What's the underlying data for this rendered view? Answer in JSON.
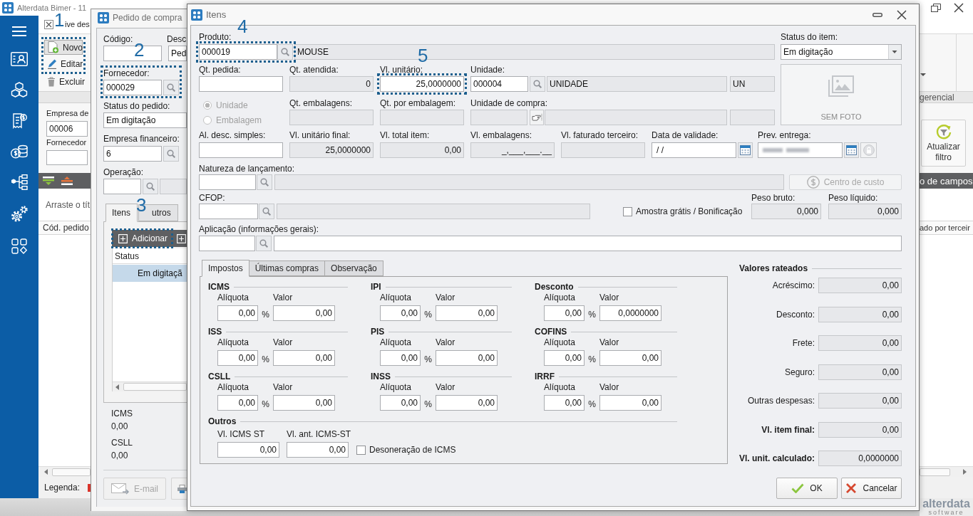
{
  "app": {
    "title": "Alterdata Bimer - 11",
    "ribbon": {
      "tab_fragment": "ive des",
      "groups": [
        {
          "callout": "1",
          "buttons": [
            {
              "label": "Novo",
              "kind": "new",
              "pressed": true
            },
            {
              "label": "Editar",
              "kind": "edit",
              "pressed": false
            }
          ]
        },
        {
          "buttons": [
            {
              "label": "Excluir",
              "kind": "delete",
              "pressed": false
            }
          ]
        }
      ],
      "group_label": "gerencial",
      "refresh_button": "Atualizar filtro"
    },
    "filters": [
      {
        "label": "Empresa de",
        "value": "00006"
      },
      {
        "label": "Fornecedor"
      }
    ],
    "group_hint": "Arraste o tít",
    "fields_bar": "o de campos",
    "grid_columns": [
      "Cód. pedido",
      "ado por terceir"
    ],
    "legend": "Legenda:",
    "logo": {
      "name": "alterdata",
      "tagline": "software"
    }
  },
  "order_window": {
    "title": "Pedido de compra",
    "code": {
      "label": "Código:"
    },
    "description": {
      "label": "Desc",
      "value": "Ped"
    },
    "supplier": {
      "label": "Fornecedor:",
      "value": "000029",
      "callout": "2"
    },
    "status": {
      "label": "Status do pedido:",
      "value": "Em digitação"
    },
    "financial_company": {
      "label": "Empresa financeiro:",
      "value": "6"
    },
    "operation": {
      "label": "Operação:"
    },
    "tabs": [
      {
        "label": "Itens",
        "selected": true
      },
      {
        "label": "utros",
        "selected": false
      }
    ],
    "add_button": {
      "label": "Adicionar",
      "callout": "3"
    },
    "grid": {
      "column": "Status",
      "rows": [
        {
          "status": "Em digitaçã",
          "selected": true
        }
      ]
    },
    "totals": [
      {
        "label": "ICMS",
        "value": "0,00"
      },
      {
        "label": "CSLL",
        "value": "0,00"
      }
    ],
    "email_button": {
      "label": "E-mail",
      "disabled": true
    }
  },
  "items_dialog": {
    "title": "Itens",
    "product": {
      "label": "Produto:",
      "code": "000019",
      "description": "MOUSE",
      "callout": "4"
    },
    "item_status": {
      "label": "Status do item:",
      "value": "Em digitação"
    },
    "photo": {
      "caption": "SEM FOTO"
    },
    "quantity_fields": [
      {
        "label": "Qt. pedida:",
        "kind": "input"
      },
      {
        "label": "Qt. atendida:",
        "kind": "readonly",
        "value": "0"
      },
      {
        "label": "Vl. unitário:",
        "kind": "input",
        "value": "25,0000000",
        "callout": "5"
      }
    ],
    "unit": {
      "label": "Unidade:",
      "code": "000004",
      "description": "UNIDADE",
      "abbreviation": "UN"
    },
    "packaging_mode": {
      "disabled": true,
      "options": [
        {
          "label": "Unidade",
          "selected": true
        },
        {
          "label": "Embalagem",
          "selected": false
        }
      ]
    },
    "packaging_fields": [
      {
        "label": "Qt. embalagens:",
        "kind": "readonly"
      },
      {
        "label": "Qt. por embalagem:",
        "kind": "readonly"
      }
    ],
    "purchase_unit": {
      "label": "Unidade de compra:"
    },
    "value_fields": [
      {
        "label": "Al. desc. simples:",
        "kind": "input"
      },
      {
        "label": "Vl. unitário final:",
        "kind": "readonly",
        "value": "25,0000000"
      },
      {
        "label": "Vl. total item:",
        "kind": "readonly",
        "value": "0,00"
      },
      {
        "label": "Vl. embalagens:",
        "kind": "readonly",
        "value": "_,___,___.__"
      },
      {
        "label": "Vl. faturado terceiro:",
        "kind": "readonly"
      }
    ],
    "validity_date": {
      "label": "Data de validade:",
      "value": "/ /"
    },
    "delivery_forecast": {
      "label": "Prev. entrega:",
      "redacted": true,
      "locked": true
    },
    "posting_nature": {
      "label": "Natureza de lançamento:"
    },
    "cost_center_button": {
      "label": "Centro de custo",
      "disabled": true
    },
    "cfop": {
      "label": "CFOP:"
    },
    "free_sample": {
      "label": "Amostra grátis / Bonificação",
      "checked": false
    },
    "weights": [
      {
        "label": "Peso bruto:",
        "value": "0,000"
      },
      {
        "label": "Peso líquido:",
        "value": "0,000"
      }
    ],
    "application": {
      "label": "Aplicação (informações gerais):"
    },
    "tabs": [
      {
        "label": "Impostos",
        "selected": true
      },
      {
        "label": "Últimas compras",
        "selected": false
      },
      {
        "label": "Observação",
        "selected": false
      }
    ],
    "taxes": [
      {
        "name": "ICMS",
        "rate_label": "Alíquota",
        "rate": "0,00",
        "unit": "%",
        "value_label": "Valor",
        "value": "0,00"
      },
      {
        "name": "IPI",
        "rate_label": "Alíquota",
        "rate": "0,00",
        "unit": "%",
        "value_label": "Valor",
        "value": "0,00"
      },
      {
        "name": "Desconto",
        "rate_label": "Alíquota",
        "rate": "0,00",
        "unit": "%",
        "value_label": "Valor",
        "value": "0,0000000"
      },
      {
        "name": "ISS",
        "rate_label": "Alíquota",
        "rate": "0,00",
        "unit": "%",
        "value_label": "Valor",
        "value": "0,00"
      },
      {
        "name": "PIS",
        "rate_label": "Alíquota",
        "rate": "0,00",
        "unit": "%",
        "value_label": "Valor",
        "value": "0,00"
      },
      {
        "name": "COFINS",
        "rate_label": "Alíquota",
        "rate": "0,00",
        "unit": "%",
        "value_label": "Valor",
        "value": "0,00"
      },
      {
        "name": "CSLL",
        "rate_label": "Alíquota",
        "rate": "0,00",
        "unit": "%",
        "value_label": "Valor",
        "value": "0,00"
      },
      {
        "name": "INSS",
        "rate_label": "Alíquota",
        "rate": "0,00",
        "unit": "%",
        "value_label": "Valor",
        "value": "0,00"
      },
      {
        "name": "IRRF",
        "rate_label": "Alíquota",
        "rate": "0,00",
        "unit": "%",
        "value_label": "Valor",
        "value": "0,00"
      }
    ],
    "others": {
      "title": "Outros",
      "fields": [
        {
          "label": "Vl. ICMS ST",
          "value": "0,00"
        },
        {
          "label": "Vl. ant. ICMS-ST",
          "value": "0,00"
        }
      ],
      "exemption": {
        "label": "Desoneração de ICMS",
        "checked": false
      }
    },
    "prorated": {
      "title": "Valores rateados",
      "rows": [
        {
          "label": "Acréscimo:",
          "value": "0,00",
          "emphasized": false
        },
        {
          "label": "Desconto:",
          "value": "0,00",
          "emphasized": false
        },
        {
          "label": "Frete:",
          "value": "0,00",
          "emphasized": false
        },
        {
          "label": "Seguro:",
          "value": "0,00",
          "emphasized": false
        },
        {
          "label": "Outras despesas:",
          "value": "0,00",
          "emphasized": false
        },
        {
          "label": "Vl. item final:",
          "value": "0,00",
          "emphasized": true
        },
        {
          "label": "Vl. unit. calculado:",
          "value": "0,0000000",
          "emphasized": true
        }
      ]
    },
    "buttons": [
      {
        "label": "OK",
        "kind": "confirm"
      },
      {
        "label": "Cancelar",
        "kind": "cancel"
      }
    ]
  }
}
